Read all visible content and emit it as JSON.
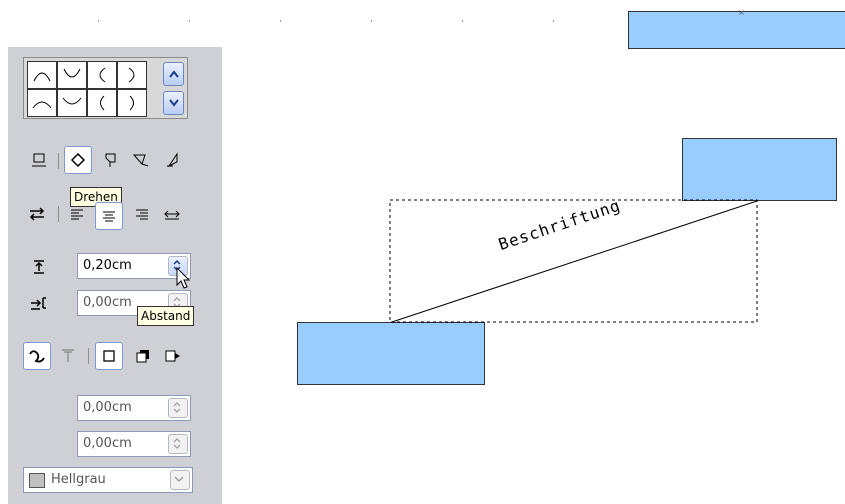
{
  "panel": {
    "tooltip_rotate": "Drehen",
    "tooltip_spacing": "Abstand",
    "spacing_top_value": "0,20cm",
    "spacing_left_value": "0,00cm",
    "offset_x_value": "0,00cm",
    "offset_y_value": "0,00cm",
    "shadow_color_label": "Hellgrau"
  },
  "canvas": {
    "label": "Beschriftung"
  },
  "colors": {
    "shape_fill": "#99ccff",
    "panel_bg": "#cfcfd6",
    "shadow_swatch": "#c0c0c0"
  },
  "icons": {
    "gallery": [
      "arc-up-icon",
      "arc-down-icon",
      "bracket-open-icon",
      "bracket-close-icon",
      "curve-up-icon",
      "curve-down-icon",
      "paren-open-icon",
      "paren-close-icon"
    ]
  }
}
